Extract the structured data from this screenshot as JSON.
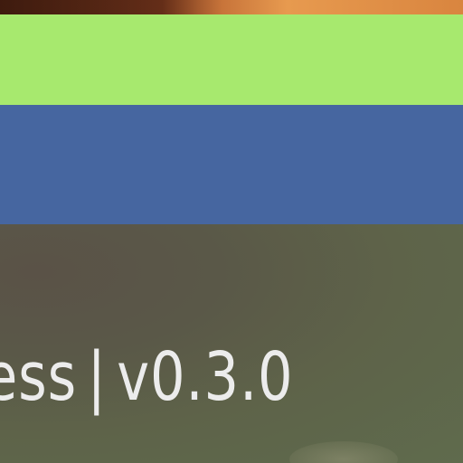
{
  "footer": {
    "app_name_fragment": "ess",
    "separator": "|",
    "version": "v0.3.0"
  },
  "colors": {
    "green_bar": "#a7e96e",
    "blue_bar": "#4666a0",
    "background": "#5b5c4a",
    "text": "#ececec"
  }
}
